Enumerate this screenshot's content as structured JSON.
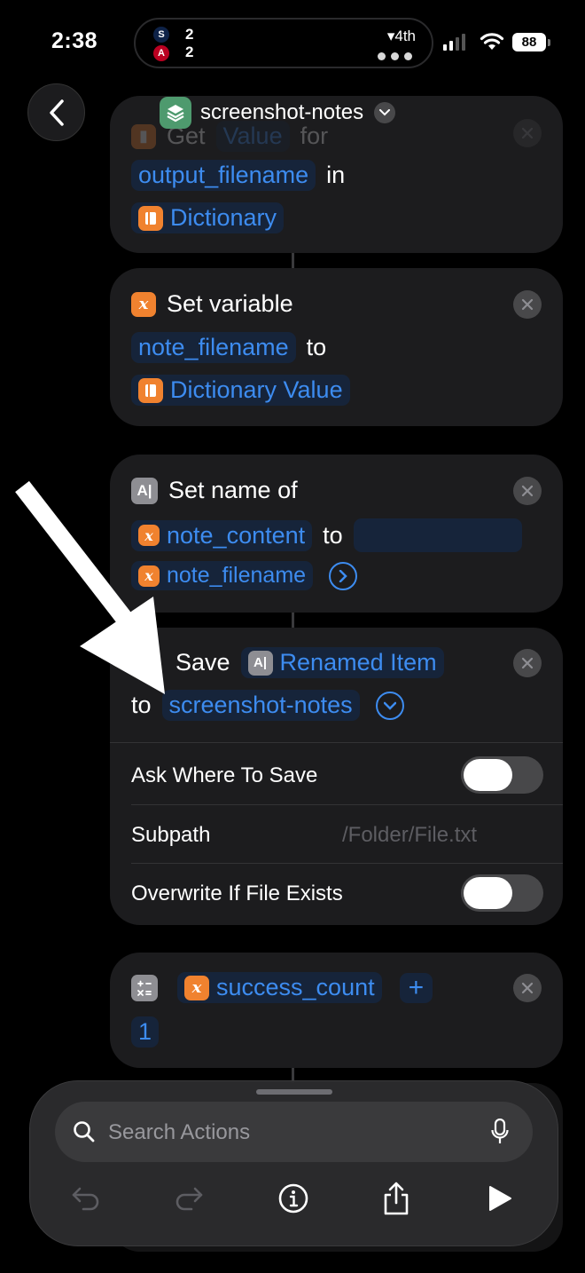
{
  "status_bar": {
    "time": "2:38",
    "live_activity": {
      "team_a_logo": "S",
      "team_b_logo": "A",
      "team_a_score": "2",
      "team_b_score": "2",
      "inning": "▾4th"
    },
    "battery": "88"
  },
  "header": {
    "title": "screenshot-notes"
  },
  "cards": {
    "get_value": {
      "action_label": "Get",
      "value_token": "Value",
      "for_label": "for",
      "key_token": "output_filename",
      "in_label": "in",
      "dict_token": "Dictionary"
    },
    "set_variable": {
      "action_label": "Set variable",
      "var_token": "note_filename",
      "to_label": "to",
      "value_token": "Dictionary Value"
    },
    "set_name": {
      "action_label": "Set name of",
      "item_token": "note_content",
      "to_label": "to",
      "name_token": "note_filename"
    },
    "save": {
      "action_label": "Save",
      "item_token": "Renamed Item",
      "to_label": "to",
      "folder_token": "screenshot-notes",
      "options": {
        "ask_where": "Ask Where To Save",
        "subpath": "Subpath",
        "subpath_placeholder": "/Folder/File.txt",
        "overwrite": "Overwrite If File Exists"
      },
      "ask_where_on": false,
      "overwrite_on": false
    },
    "calculate": {
      "var_token": "success_count",
      "operator": "+",
      "operand": "1"
    }
  },
  "bottom_sheet": {
    "search_placeholder": "Search Actions"
  },
  "icons": {
    "back": "chevron-left-icon",
    "app": "layers-icon",
    "variable": "x-variable-icon",
    "dictionary": "book-icon",
    "text": "text-cursor-icon",
    "calculator": "calculator-icon",
    "mic": "microphone-icon",
    "undo": "undo-icon",
    "redo": "redo-icon",
    "info": "info-icon",
    "share": "share-icon",
    "play": "play-icon"
  },
  "colors": {
    "token_blue": "#3d8cf0",
    "variable_orange": "#f0822f",
    "card_bg": "#1c1c1e"
  }
}
